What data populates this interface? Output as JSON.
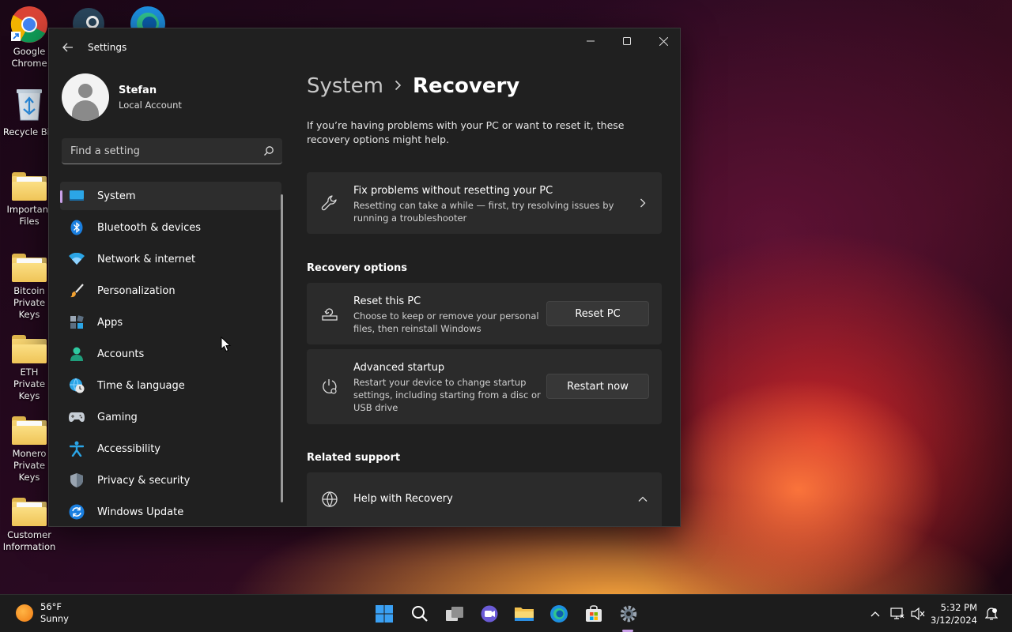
{
  "desktop": {
    "icons": [
      {
        "label": "Google Chrome"
      },
      {
        "label": "Recycle Bin"
      },
      {
        "label": "Important Files"
      },
      {
        "label": "Bitcoin Private Keys"
      },
      {
        "label": "ETH Private Keys"
      },
      {
        "label": "Monero Private Keys"
      },
      {
        "label": "Customer Information"
      }
    ]
  },
  "window": {
    "title": "Settings",
    "controls": {
      "minimize": "minimize-icon",
      "maximize": "maximize-icon",
      "close": "close-icon"
    }
  },
  "user": {
    "name": "Stefan",
    "account_type": "Local Account"
  },
  "search": {
    "placeholder": "Find a setting"
  },
  "nav": {
    "items": [
      {
        "label": "System",
        "icon": "monitor-icon",
        "active": true
      },
      {
        "label": "Bluetooth & devices",
        "icon": "bluetooth-icon"
      },
      {
        "label": "Network & internet",
        "icon": "wifi-icon"
      },
      {
        "label": "Personalization",
        "icon": "brush-icon"
      },
      {
        "label": "Apps",
        "icon": "apps-icon"
      },
      {
        "label": "Accounts",
        "icon": "person-icon"
      },
      {
        "label": "Time & language",
        "icon": "globe-clock-icon"
      },
      {
        "label": "Gaming",
        "icon": "gamepad-icon"
      },
      {
        "label": "Accessibility",
        "icon": "accessibility-icon"
      },
      {
        "label": "Privacy & security",
        "icon": "shield-icon"
      },
      {
        "label": "Windows Update",
        "icon": "update-icon"
      }
    ]
  },
  "content": {
    "breadcrumb": {
      "parent": "System",
      "current": "Recovery"
    },
    "intro": "If you’re having problems with your PC or want to reset it, these recovery options might help.",
    "fix_card": {
      "title": "Fix problems without resetting your PC",
      "desc": "Resetting can take a while — first, try resolving issues by running a troubleshooter"
    },
    "recovery_options_title": "Recovery options",
    "reset_card": {
      "title": "Reset this PC",
      "desc": "Choose to keep or remove your personal files, then reinstall Windows",
      "button": "Reset PC"
    },
    "advanced_card": {
      "title": "Advanced startup",
      "desc": "Restart your device to change startup settings, including starting from a disc or USB drive",
      "button": "Restart now"
    },
    "related_support_title": "Related support",
    "help_card": {
      "title": "Help with Recovery"
    }
  },
  "taskbar": {
    "weather": {
      "temp": "56°F",
      "condition": "Sunny"
    },
    "clock": {
      "time": "5:32 PM",
      "date": "3/12/2024"
    }
  }
}
